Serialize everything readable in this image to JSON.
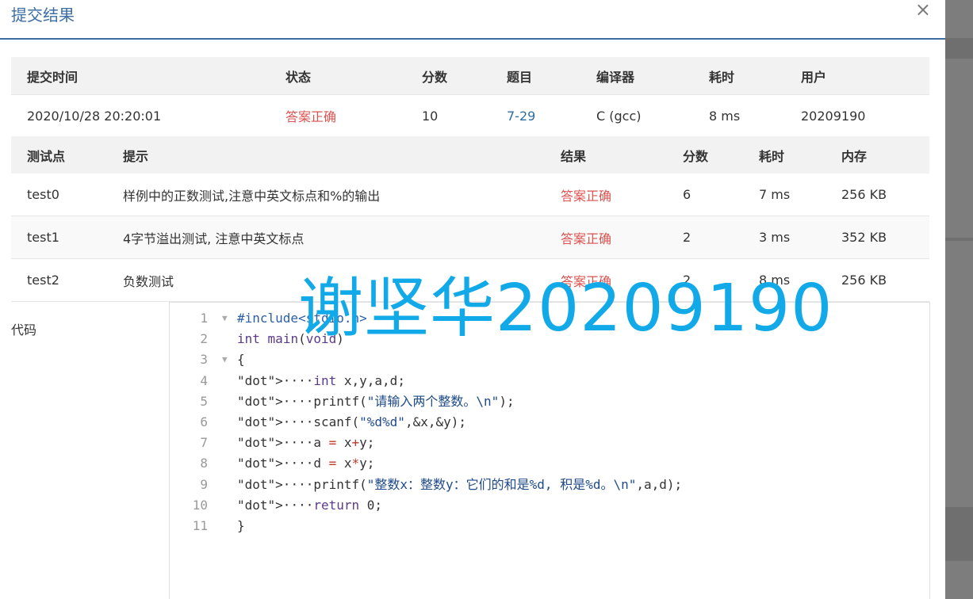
{
  "modal": {
    "title": "提交结果",
    "close_label": "×"
  },
  "summary": {
    "headers": [
      "提交时间",
      "状态",
      "分数",
      "题目",
      "编译器",
      "耗时",
      "用户"
    ],
    "row": {
      "time": "2020/10/28 20:20:01",
      "status": "答案正确",
      "score": "10",
      "problem": "7-29",
      "compiler": "C (gcc)",
      "elapsed": "8 ms",
      "user": "20209190"
    }
  },
  "tests": {
    "headers": [
      "测试点",
      "提示",
      "结果",
      "分数",
      "耗时",
      "内存"
    ],
    "rows": [
      {
        "id": "test0",
        "hint": "样例中的正数测试,注意中英文标点和%的输出",
        "result": "答案正确",
        "score": "6",
        "time": "7 ms",
        "memory": "256 KB"
      },
      {
        "id": "test1",
        "hint": "4字节溢出测试, 注意中英文标点",
        "result": "答案正确",
        "score": "2",
        "time": "3 ms",
        "memory": "352 KB"
      },
      {
        "id": "test2",
        "hint": "负数测试",
        "result": "答案正确",
        "score": "2",
        "time": "8 ms",
        "memory": "256 KB"
      }
    ]
  },
  "code": {
    "label": "代码",
    "lines": [
      "#include<stdio.h>",
      "int main(void)",
      "{",
      "····int x,y,a,d;",
      "····printf(\"请输入两个整数。\\n\");",
      "····scanf(\"%d%d\",&x,&y);",
      "····a = x+y;",
      "····d = x*y;",
      "····printf(\"整数x：整数y：它们的和是%d, 积是%d。\\n\",a,d);",
      "····return 0;",
      "}"
    ]
  },
  "watermark": "谢坚华20209190",
  "colors": {
    "accent": "#3b6ea5",
    "success": "#d9534f",
    "watermark": "#12a9e8"
  }
}
